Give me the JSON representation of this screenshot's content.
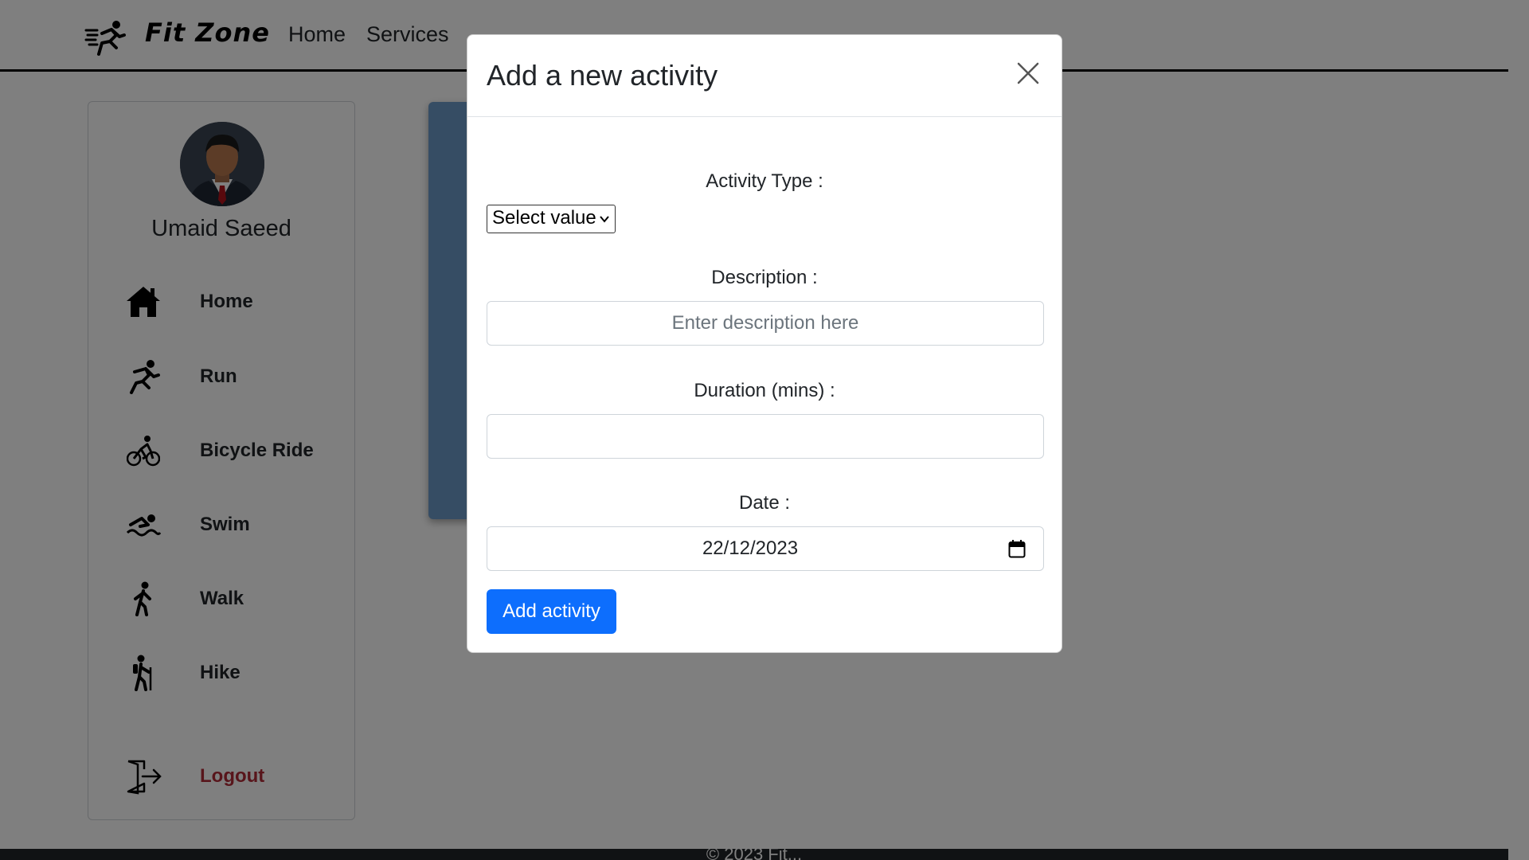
{
  "navbar": {
    "brand": "Fit Zone",
    "links": [
      {
        "label": "Home"
      },
      {
        "label": "Services"
      }
    ]
  },
  "sidebar": {
    "user_name": "Umaid Saeed",
    "items": [
      {
        "label": "Home",
        "icon": "home-icon"
      },
      {
        "label": "Run",
        "icon": "run-icon"
      },
      {
        "label": "Bicycle Ride",
        "icon": "bicycle-icon"
      },
      {
        "label": "Swim",
        "icon": "swim-icon"
      },
      {
        "label": "Walk",
        "icon": "walk-icon"
      },
      {
        "label": "Hike",
        "icon": "hike-icon"
      }
    ],
    "logout": {
      "label": "Logout",
      "icon": "logout-icon",
      "color": "#b02a37"
    }
  },
  "modal": {
    "title": "Add a new activity",
    "activity_type": {
      "label": "Activity Type :",
      "selected": "Select value"
    },
    "description": {
      "label": "Description :",
      "placeholder": "Enter description here",
      "value": ""
    },
    "duration": {
      "label": "Duration (mins) :",
      "value": ""
    },
    "date": {
      "label": "Date :",
      "value": "22/12/2023"
    },
    "submit_label": "Add activity"
  },
  "footer": {
    "text": "© 2023 Fit..."
  },
  "colors": {
    "primary": "#0d6efd",
    "logout": "#b02a37",
    "backdrop": "rgba(0,0,0,0.5)"
  }
}
